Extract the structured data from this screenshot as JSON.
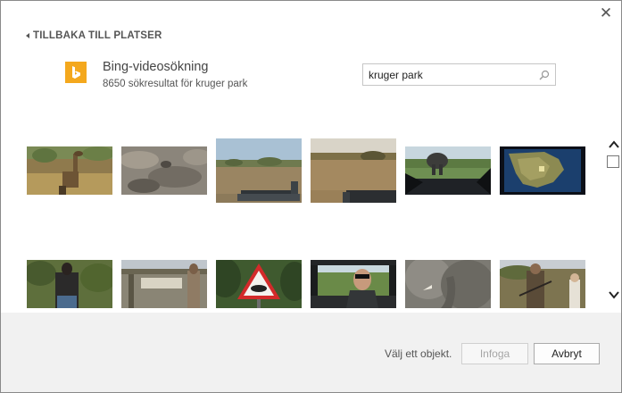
{
  "dialog": {
    "close_glyph": "✕",
    "back_label": "TILLBAKA TILL PLATSER"
  },
  "service": {
    "logo_icon": "bing-logo-icon",
    "logo_color": "#f4a81d",
    "title": "Bing-videosökning",
    "subtitle": "8650 sökresultat för kruger park"
  },
  "search": {
    "value": "kruger park",
    "icon": "magnifier-icon"
  },
  "results": {
    "thumbnails": [
      {
        "name": "giraffe"
      },
      {
        "name": "rocky-ground"
      },
      {
        "name": "savanna-vehicle"
      },
      {
        "name": "savanna-road"
      },
      {
        "name": "elephant-windshield"
      },
      {
        "name": "map-south-africa"
      },
      {
        "name": "man-bushes"
      },
      {
        "name": "gate-sign"
      },
      {
        "name": "hippo-warning-sign"
      },
      {
        "name": "man-in-car"
      },
      {
        "name": "elephant-closeup"
      },
      {
        "name": "ranger-rifle"
      }
    ]
  },
  "scrollbar": {
    "up_icon": "chevron-up-icon",
    "down_icon": "chevron-down-icon"
  },
  "footer": {
    "status": "Välj ett objekt.",
    "insert_label": "Infoga",
    "cancel_label": "Avbryt"
  }
}
